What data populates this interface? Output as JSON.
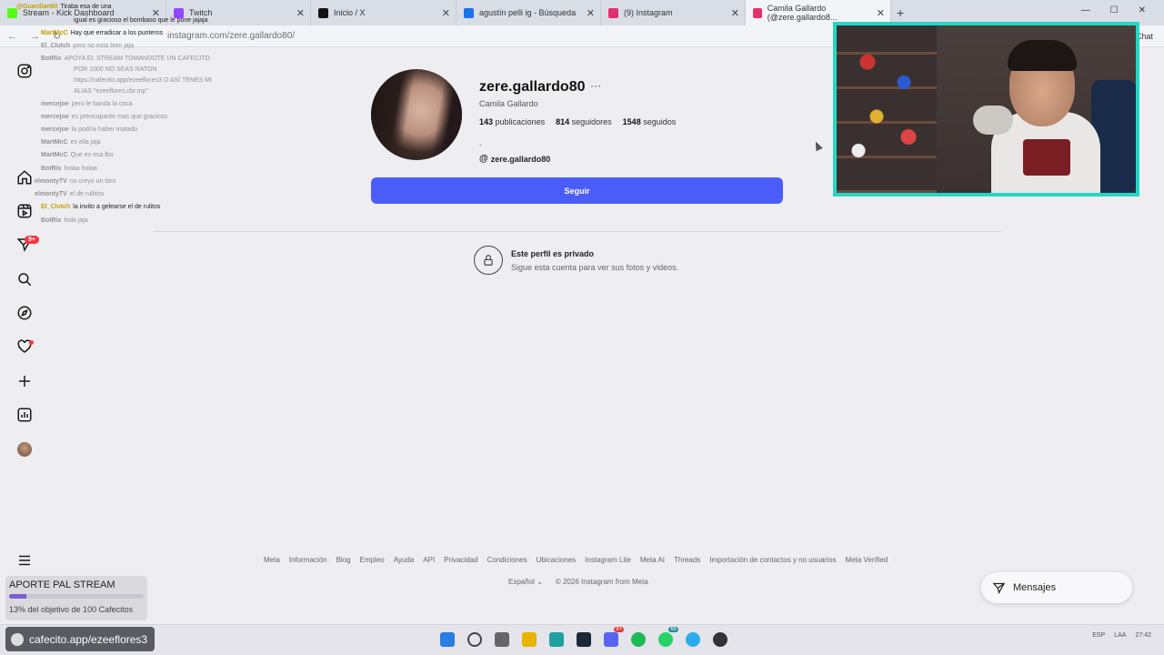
{
  "browser": {
    "tabs": [
      {
        "label": "Stream - Kick Dashboard",
        "color": "#53fc18"
      },
      {
        "label": "Twitch",
        "color": "#9146ff"
      },
      {
        "label": "Inicio / X",
        "color": "#111111"
      },
      {
        "label": "agustín pelli ig - Búsqueda",
        "color": "#1a73e8"
      },
      {
        "label": "(9) Instagram",
        "color": "#e1306c"
      },
      {
        "label": "Camila Gallardo (@zere.gallardo8...",
        "color": "#e1306c"
      }
    ],
    "url": "instagram.com/zere.gallardo80/",
    "chat_label": "Chat"
  },
  "chat": [
    {
      "user": "@Guardian90",
      "text": "Tiraba esa de una"
    },
    {
      "user": "",
      "text": "igual es gracioso el bombaso que le pone jajaja"
    },
    {
      "user": "MartMcC",
      "text": "Hay que erradicar a los punteros"
    },
    {
      "user": "El_Clutch",
      "text": "pero no esta bien jaja"
    },
    {
      "user": "BotRix",
      "text": "APOYA EL STREAM TOMANDOTE UN CAFECITO"
    },
    {
      "user": "",
      "text": "POR 1000 NO SEAS RATON"
    },
    {
      "user": "",
      "text": "https://cafecito.app/ezeeflores3 O ASÍ TENES MI"
    },
    {
      "user": "",
      "text": "ALIAS \"ezeeflores.cbr.mp\""
    },
    {
      "user": "mercejoe",
      "text": "pero le banda la coca"
    },
    {
      "user": "mercejoe",
      "text": "es preocupante mas que gracioso"
    },
    {
      "user": "mercejoe",
      "text": "la podría haber matado"
    },
    {
      "user": "MartMcC",
      "text": "es ella jaja"
    },
    {
      "user": "MartMcC",
      "text": "Que es esa lbo"
    },
    {
      "user": "BotRix",
      "text": "holaa holaa"
    },
    {
      "user": "elmontyTV",
      "text": "no creyo un toro"
    },
    {
      "user": "elmontyTV",
      "text": "el de rullitos"
    },
    {
      "user": "El_Clutch",
      "text": "la invito a gelearse el de rulitos"
    },
    {
      "user": "BotRix",
      "text": "hola jaja"
    }
  ],
  "sidebar": {
    "items": [
      {
        "name": "instagram-logo-icon"
      },
      {
        "name": "home-icon"
      },
      {
        "name": "reels-icon"
      },
      {
        "name": "messages-icon",
        "badge": "9+"
      },
      {
        "name": "search-icon"
      },
      {
        "name": "explore-icon"
      },
      {
        "name": "notifications-icon"
      },
      {
        "name": "create-icon"
      },
      {
        "name": "dashboard-icon"
      },
      {
        "name": "profile-avatar"
      },
      {
        "name": "menu-icon"
      }
    ]
  },
  "profile": {
    "username": "zere.gallardo80",
    "more": "···",
    "full_name": "Camila Gallardo",
    "posts_count": "143",
    "posts_label": "publicaciones",
    "followers_count": "814",
    "followers_label": "seguidores",
    "following_count": "1548",
    "following_label": "seguidos",
    "bio": ".",
    "threads_handle": "zere.gallardo80",
    "follow_label": "Seguir",
    "private_title": "Este perfil es privado",
    "private_sub": "Sigue esta cuenta para ver sus fotos y videos."
  },
  "footer": {
    "links": [
      "Meta",
      "Información",
      "Blog",
      "Empleo",
      "Ayuda",
      "API",
      "Privacidad",
      "Condiciones",
      "Ubicaciones",
      "Instagram Lite",
      "Meta AI",
      "Threads",
      "Importación de contactos y no usuarios",
      "Meta Verified"
    ],
    "language": "Español",
    "copyright": "© 2026 Instagram from Meta"
  },
  "messages_button": "Mensajes",
  "donation": {
    "title": "APORTE PAL STREAM",
    "progress": 0.13,
    "subtitle": "13% del objetivo de 100 Cafecitos"
  },
  "taskbar": {
    "pill_label": "cafecito.app/ezeeflores3",
    "discord_badge": "9+",
    "whatsapp_badge": "65",
    "tray": [
      "ESP",
      "LAA",
      "27:42"
    ]
  },
  "colors": {
    "accent": "#4a5df9",
    "webcam_border": "#25d6c4"
  }
}
